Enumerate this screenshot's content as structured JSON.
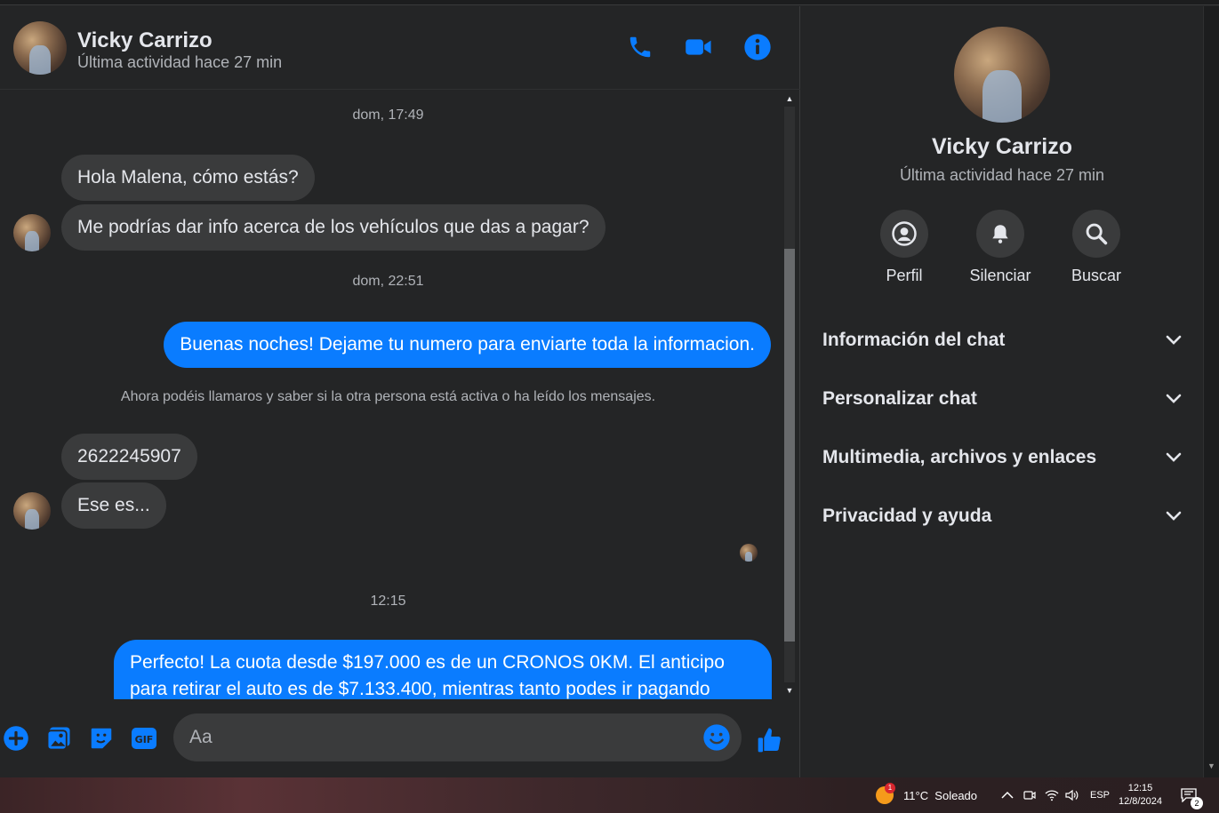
{
  "contact": {
    "name": "Vicky Carrizo",
    "status": "Última actividad hace 27 min"
  },
  "header_actions": [
    "phone-icon",
    "video-icon",
    "info-icon"
  ],
  "accent_color": "#0a7cff",
  "messages": {
    "ts1": "dom, 17:49",
    "m1": "Hola Malena, cómo estás?",
    "m2": "Me podrías dar info acerca de los vehículos que das a pagar?",
    "ts2": "dom, 22:51",
    "m3": "Buenas noches! Dejame tu numero para enviarte toda la informacion.",
    "notice": "Ahora podéis llamaros y saber si la otra persona está activa o ha leído los mensajes.",
    "m4": "2622245907",
    "m5": "Ese es...",
    "ts3": "12:15",
    "m6_line1": "Perfecto! La cuota desde $197.000 es de un CRONOS 0KM. El anticipo",
    "m6_line2": "para retirar el auto es de $7.133.400, mientras tanto podes ir pagando"
  },
  "composer": {
    "placeholder": "Aa",
    "icons": [
      "plus-icon",
      "gallery-icon",
      "sticker-icon",
      "gif-icon",
      "emoji-icon",
      "like-icon"
    ],
    "gif_label": "GIF"
  },
  "info_panel": {
    "name": "Vicky Carrizo",
    "status": "Última actividad hace 27 min",
    "actions": [
      {
        "label": "Perfil",
        "icon": "profile-icon"
      },
      {
        "label": "Silenciar",
        "icon": "bell-icon"
      },
      {
        "label": "Buscar",
        "icon": "search-icon"
      }
    ],
    "sections": [
      "Información del chat",
      "Personalizar chat",
      "Multimedia, archivos y enlaces",
      "Privacidad y ayuda"
    ]
  },
  "taskbar": {
    "weather_badge": "1",
    "weather": "11°C  Soleado",
    "lang": "ESP",
    "time": "12:15",
    "date": "12/8/2024",
    "notifications": "2"
  }
}
